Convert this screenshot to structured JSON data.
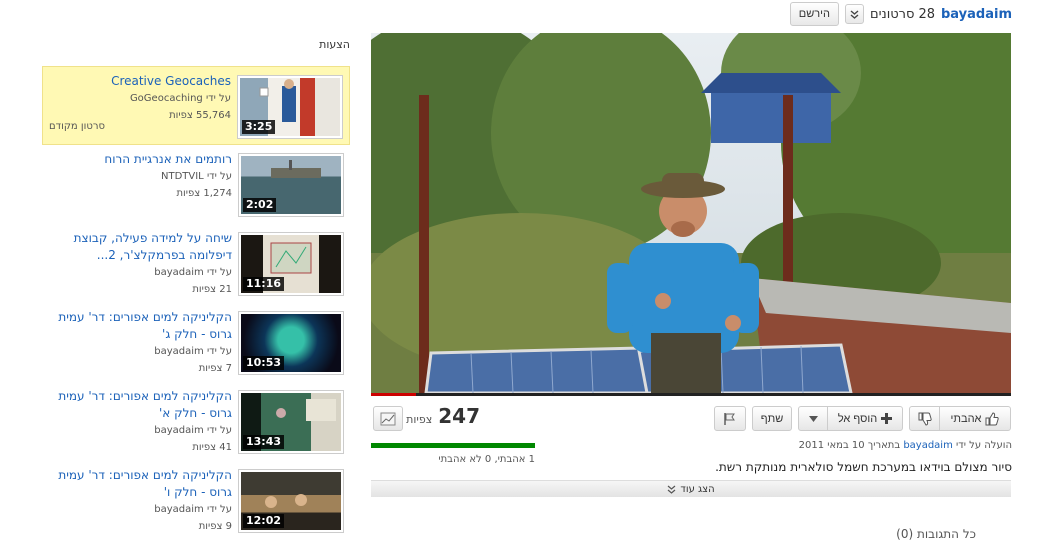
{
  "channel": {
    "name": "bayadaim",
    "video_count": "28",
    "videos_label": "סרטונים",
    "subscribe_label": "הירשם"
  },
  "sidebar": {
    "title": "הצעות",
    "items": [
      {
        "title": "Creative Geocaches",
        "by_label": "על ידי",
        "author": "GoGeocaching",
        "views": "55,764",
        "views_label": "צפיות",
        "duration": "3:25",
        "extra": "סרטון מקודם"
      },
      {
        "title": "רותמים את אנרגיית הרוח",
        "by_label": "על ידי",
        "author": "NTDTVIL",
        "views": "1,274",
        "views_label": "צפיות",
        "duration": "2:02"
      },
      {
        "title": "שיחה על למידה פעילה, קבוצת דיפלומה בפרמקלצ'ר, 2...",
        "by_label": "על ידי",
        "author": "bayadaim",
        "views": "21",
        "views_label": "צפיות",
        "duration": "11:16"
      },
      {
        "title": "הקליניקה למים אפורים: דר' עמית גרוס - חלק ג'",
        "by_label": "על ידי",
        "author": "bayadaim",
        "views": "7",
        "views_label": "צפיות",
        "duration": "10:53"
      },
      {
        "title": "הקליניקה למים אפורים: דר' עמית גרוס - חלק א'",
        "by_label": "על ידי",
        "author": "bayadaim",
        "views": "41",
        "views_label": "צפיות",
        "duration": "13:43"
      },
      {
        "title": "הקליניקה למים אפורים: דר' עמית גרוס - חלק ו'",
        "by_label": "על ידי",
        "author": "bayadaim",
        "views": "9",
        "views_label": "צפיות",
        "duration": "12:02"
      }
    ]
  },
  "video": {
    "progress_fraction": 0.07
  },
  "actions": {
    "like_label": "אהבתי",
    "add_to_label": "הוסף אל",
    "share_label": "שתף"
  },
  "stats": {
    "views": "247",
    "views_label": "צפיות",
    "likes_text": "1 אהבתי, 0 לא אהבתי",
    "like_ratio": 1.0
  },
  "details": {
    "uploaded_prefix": "הועלה על ידי",
    "uploader": "bayadaim",
    "uploaded_date": "בתאריך 10 במאי 2011",
    "description": "סיור מצולם בוידאו במערכת חשמל סולארית מנותקת רשת.",
    "show_more_label": "הצג עוד"
  },
  "comments": {
    "title": "כל התגובות (0)"
  }
}
